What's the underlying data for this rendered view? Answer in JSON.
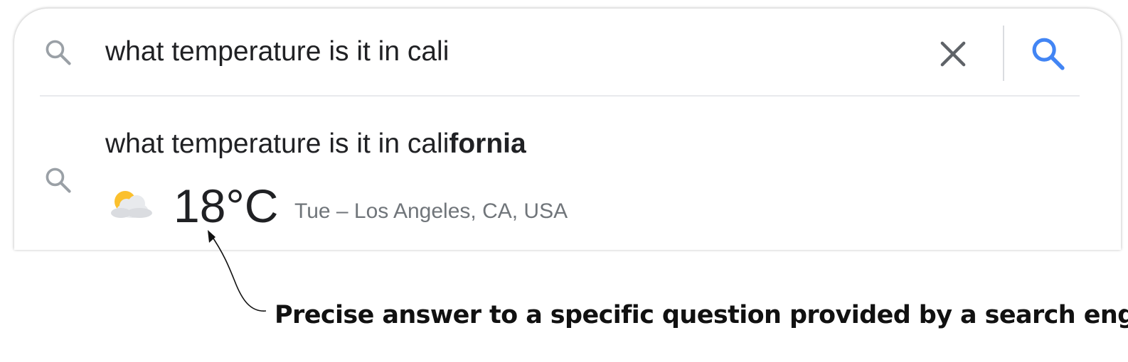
{
  "search": {
    "query": "what temperature is it in cali",
    "icons": {
      "leading": "search-icon",
      "clear": "close-icon",
      "submit": "search-icon"
    },
    "accent_color": "#4285f4"
  },
  "suggestion": {
    "prefix": "what temperature is it in cali",
    "completion": "fornia",
    "icon": "search-icon",
    "weather": {
      "icon": "partly-cloudy-icon",
      "temperature": "18°C",
      "details": "Tue – Los Angeles, CA, USA"
    }
  },
  "annotation": {
    "caption": "Precise answer to a specific question provided by a search engine"
  }
}
